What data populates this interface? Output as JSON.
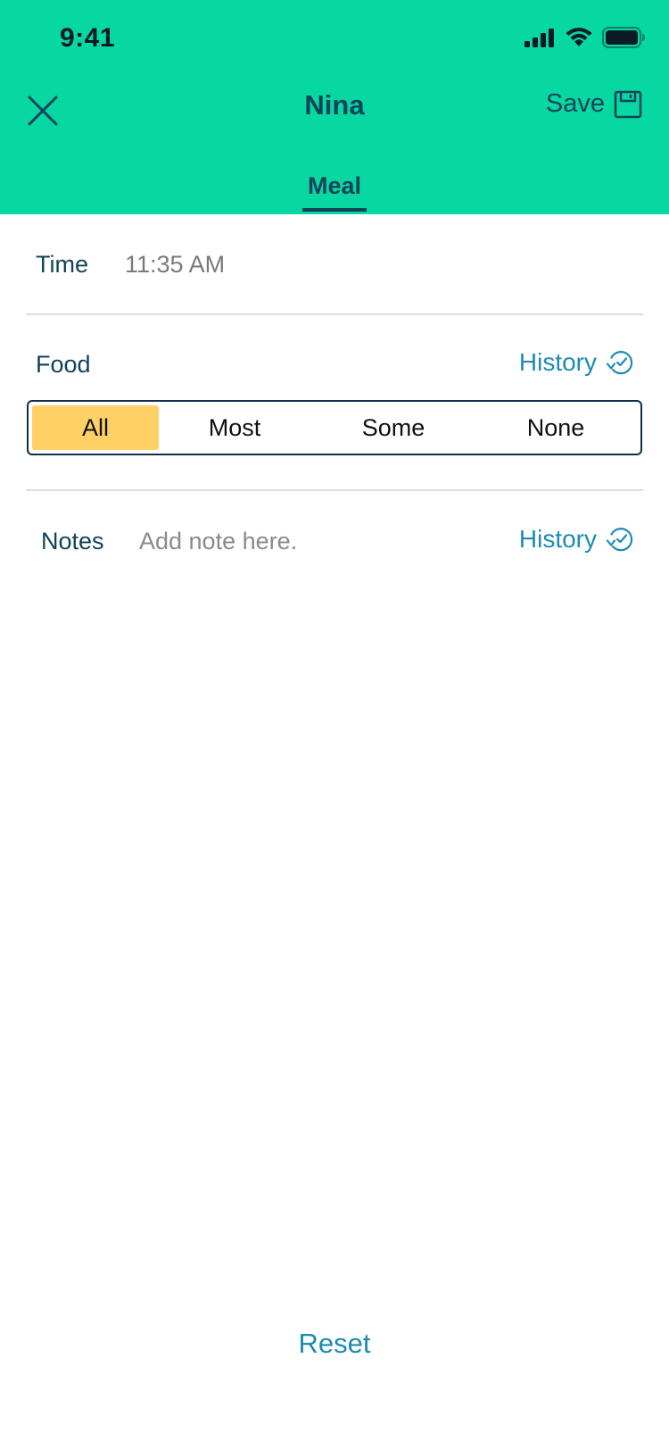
{
  "status_bar": {
    "time": "9:41"
  },
  "header": {
    "title": "Nina",
    "save_label": "Save",
    "tab_label": "Meal"
  },
  "time_row": {
    "label": "Time",
    "value": "11:35 AM"
  },
  "food_row": {
    "label": "Food",
    "history_label": "History",
    "options": [
      "All",
      "Most",
      "Some",
      "None"
    ],
    "selected": "All"
  },
  "notes_row": {
    "label": "Notes",
    "placeholder": "Add note here.",
    "history_label": "History"
  },
  "footer": {
    "reset_label": "Reset"
  },
  "colors": {
    "header_bg": "#07d7a0",
    "primary_text": "#10435a",
    "link": "#1d8bb3",
    "selected_option": "#ffd065"
  },
  "icons": [
    "close-icon",
    "save-disk-icon",
    "history-clock-icon",
    "signal-icon",
    "wifi-icon",
    "battery-icon"
  ]
}
